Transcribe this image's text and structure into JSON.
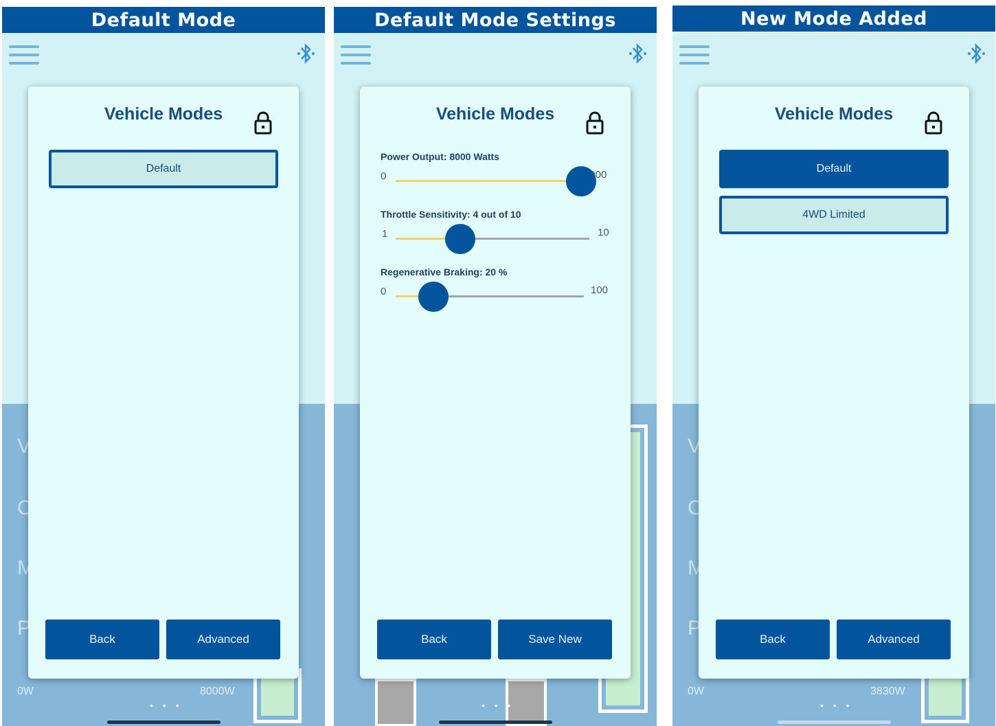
{
  "colors": {
    "header": "#02549c",
    "modal_bg": "#e3fdfc",
    "button": "#02549c",
    "selected_fill": "#c9ebea",
    "slider_fill": "#f2d25a"
  },
  "panels": [
    {
      "header": "Default Mode",
      "modal_title": "Vehicle Modes",
      "modes": [
        {
          "label": "Default",
          "selected": true
        }
      ],
      "footer": {
        "back": "Back",
        "right": "Advanced"
      },
      "bg_power_left": "0W",
      "bg_power_right": "8000W"
    },
    {
      "header": "Default Mode Settings",
      "modal_title": "Vehicle Modes",
      "sliders": [
        {
          "label": "Power Output: 8000 Watts",
          "min": "0",
          "max": "8000",
          "value": 8000,
          "min_value": 0,
          "max_value": 8000
        },
        {
          "label": "Throttle Sensitivity: 4 out of 10",
          "min": "1",
          "max": "10",
          "value": 4,
          "min_value": 1,
          "max_value": 10
        },
        {
          "label": "Regenerative Braking: 20 %",
          "min": "0",
          "max": "100",
          "value": 20,
          "min_value": 0,
          "max_value": 100
        }
      ],
      "footer": {
        "back": "Back",
        "right": "Save New"
      }
    },
    {
      "header": "New Mode Added",
      "modal_title": "Vehicle Modes",
      "modes": [
        {
          "label": "Default",
          "selected": false
        },
        {
          "label": "4WD Limited",
          "selected": true
        }
      ],
      "footer": {
        "back": "Back",
        "right": "Advanced"
      },
      "bg_power_left": "0W",
      "bg_power_right": "3830W"
    }
  ]
}
